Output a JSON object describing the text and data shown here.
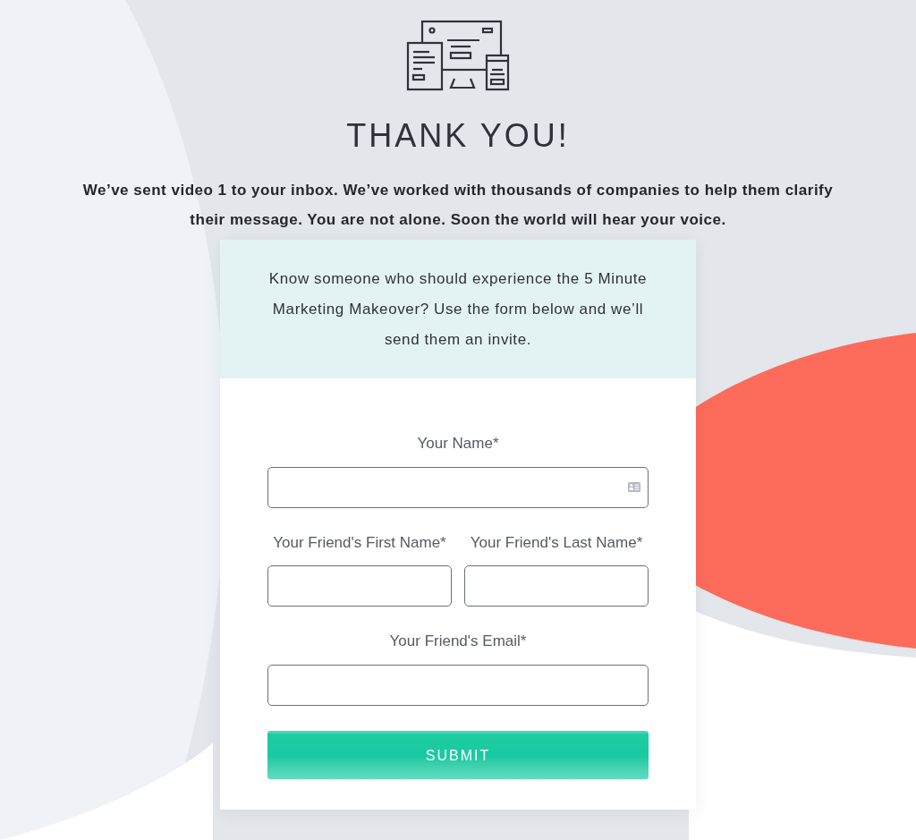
{
  "title": "THANK YOU!",
  "message": "We’ve sent video 1 to your inbox. We’ve worked with thousands of companies to help them clarify their message. You are not alone. Soon the world will hear your voice.",
  "card": {
    "intro": "Know someone who should experience the 5 Minute Marketing Makeover? Use the form below and we’ll send them an invite.",
    "fields": [
      {
        "kind": "full",
        "label": "Your Name*",
        "contact_icon": true
      },
      {
        "kind": "half",
        "label": "Your Friend's First Name*",
        "contact_icon": false
      },
      {
        "kind": "half",
        "label": "Your Friend's Last Name*",
        "contact_icon": false
      },
      {
        "kind": "full",
        "label": "Your Friend's Email*",
        "contact_icon": false
      }
    ],
    "submit": "SUBMIT"
  }
}
